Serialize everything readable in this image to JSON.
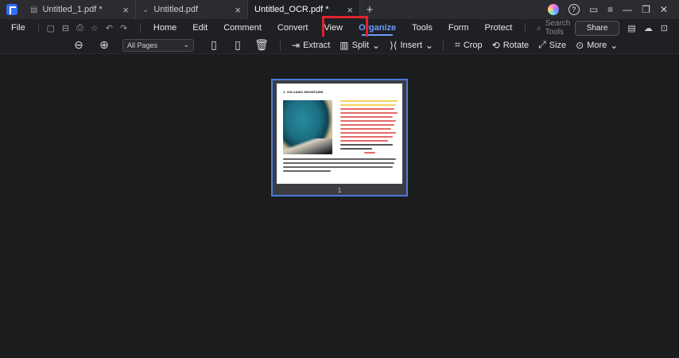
{
  "tabs": [
    {
      "icon": "pdf-file-icon",
      "title": "Untitled_1.pdf *",
      "active": false
    },
    {
      "icon": "chevron-down-icon",
      "title": "Untitled.pdf",
      "active": false
    },
    {
      "icon": "",
      "title": "Untitled_OCR.pdf *",
      "active": true
    }
  ],
  "new_tab": "+",
  "window_controls": {
    "minimize": "—",
    "restore": "❐",
    "close": "✕"
  },
  "menu": {
    "file": "File",
    "items": [
      "Home",
      "Edit",
      "Comment",
      "Convert",
      "View",
      "Organize",
      "Tools",
      "Form",
      "Protect"
    ],
    "active": "Organize",
    "search_placeholder": "Search Tools",
    "share": "Share"
  },
  "toolbar": {
    "pages_select": "All Pages",
    "buttons": [
      "Extract",
      "Split",
      "Insert",
      "Crop",
      "Rotate",
      "Size",
      "More"
    ]
  },
  "document": {
    "page_number": "1",
    "heading": "1. VOLCANIC MOUNTAINS"
  },
  "colors": {
    "accent": "#6a9cff",
    "highlight_box": "#e0232e",
    "page_border": "#4b7bdc"
  }
}
